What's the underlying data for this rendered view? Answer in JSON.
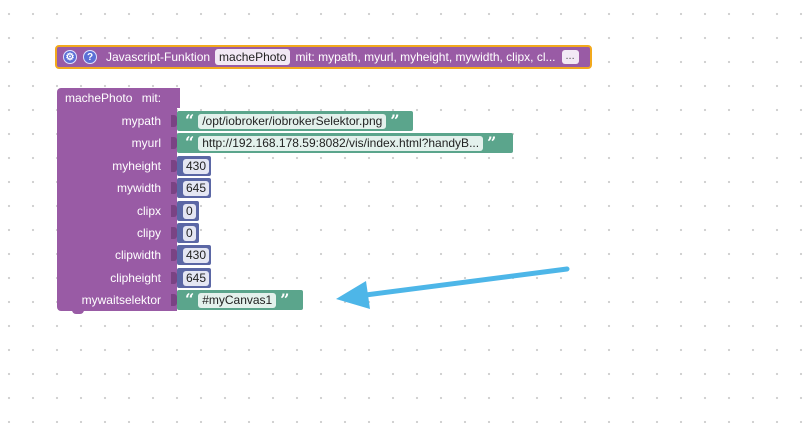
{
  "function_block": {
    "gear_icon": "gear-icon",
    "help_icon": "?",
    "label": "Javascript-Funktion",
    "name": "machePhoto",
    "params_text": "mit: mypath, myurl, myheight, mywidth, clipx, cl...",
    "ellipsis": "..."
  },
  "call_block": {
    "title": "machePhoto",
    "with_label": "mit:",
    "args": [
      {
        "name": "mypath",
        "type": "text",
        "value": "/opt/iobroker/iobrokerSelektor.png"
      },
      {
        "name": "myurl",
        "type": "text",
        "value": "http://192.168.178.59:8082/vis/index.html?handyB..."
      },
      {
        "name": "myheight",
        "type": "number",
        "value": "430"
      },
      {
        "name": "mywidth",
        "type": "number",
        "value": "645"
      },
      {
        "name": "clipx",
        "type": "number",
        "value": "0"
      },
      {
        "name": "clipy",
        "type": "number",
        "value": "0"
      },
      {
        "name": "clipwidth",
        "type": "number",
        "value": "430"
      },
      {
        "name": "clipheight",
        "type": "number",
        "value": "645"
      },
      {
        "name": "mywaitselektor",
        "type": "text",
        "value": "#myCanvas1"
      }
    ]
  },
  "quote_open": "“",
  "quote_close": "”",
  "colors": {
    "procedure": "#995ba5",
    "text_block": "#5ba58c",
    "number_block": "#5b67a5",
    "highlight_border": "#f2a91d",
    "annotation_arrow": "#4db6e8"
  }
}
